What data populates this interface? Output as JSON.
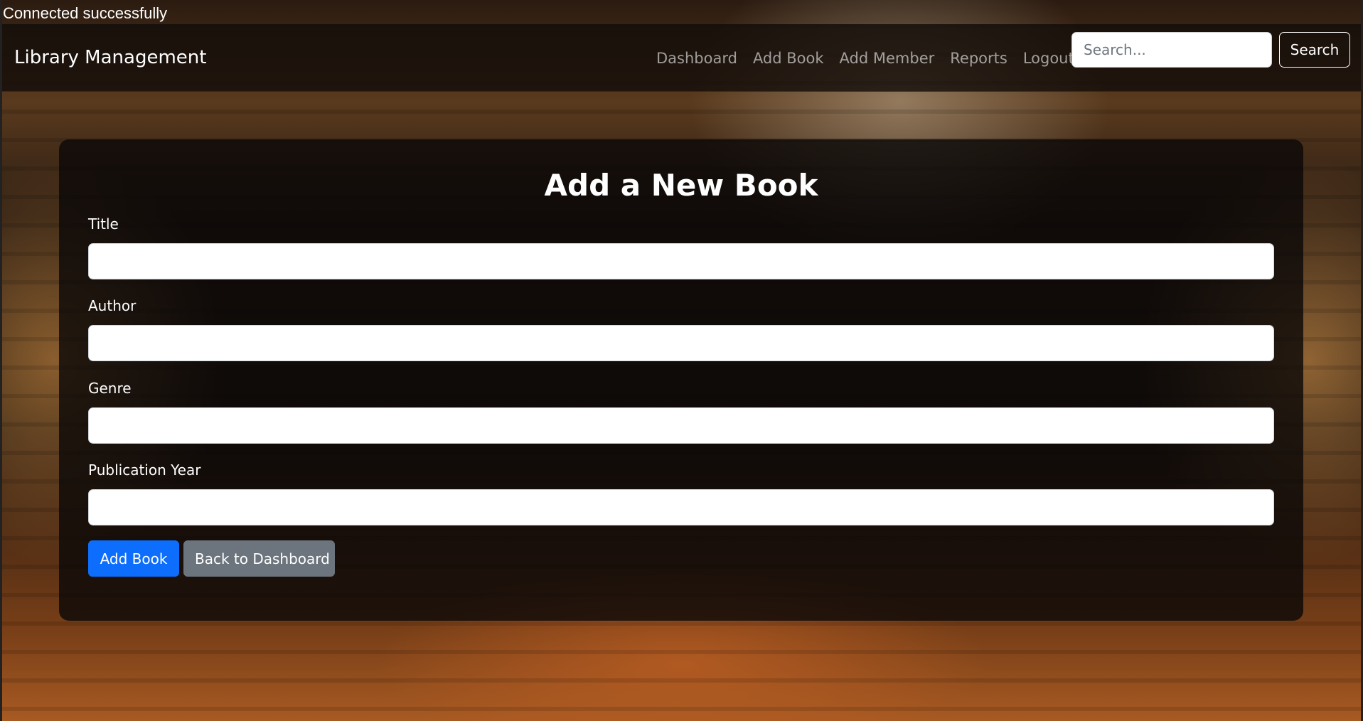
{
  "status": {
    "message": "Connected successfully"
  },
  "navbar": {
    "brand": "Library Management",
    "links": [
      {
        "label": "Dashboard"
      },
      {
        "label": "Add Book"
      },
      {
        "label": "Add Member"
      },
      {
        "label": "Reports"
      },
      {
        "label": "Logout"
      }
    ],
    "search": {
      "placeholder": "Search...",
      "value": "",
      "button_label": "Search"
    }
  },
  "form": {
    "title": "Add a New Book",
    "fields": [
      {
        "label": "Title",
        "value": ""
      },
      {
        "label": "Author",
        "value": ""
      },
      {
        "label": "Genre",
        "value": ""
      },
      {
        "label": "Publication Year",
        "value": ""
      }
    ],
    "submit_label": "Add Book",
    "back_label": "Back to Dashboard"
  },
  "colors": {
    "primary": "#0d6efd",
    "secondary": "#6c757d",
    "nav_background": "#140e0a"
  }
}
